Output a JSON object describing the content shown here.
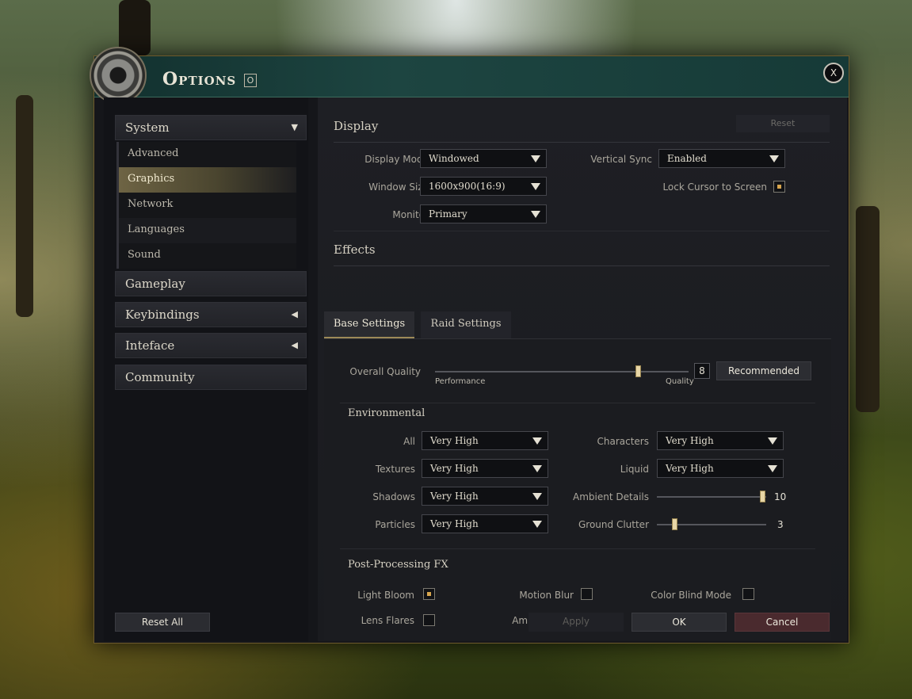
{
  "window": {
    "title": "Options",
    "title_key": "O",
    "close_label": "X"
  },
  "nav": {
    "system": "System",
    "system_subitems": [
      "Advanced",
      "Graphics",
      "Network",
      "Languages",
      "Sound"
    ],
    "active_subitem": "Graphics",
    "gameplay": "Gameplay",
    "keybindings": "Keybindings",
    "interface": "Inteface",
    "community": "Community",
    "reset_all": "Reset All"
  },
  "display": {
    "title": "Display",
    "reset": "Reset",
    "display_mode_label": "Display Mode",
    "display_mode": "Windowed",
    "window_size_label": "Window Size",
    "window_size": "1600x900(16:9)",
    "monitor_label": "Monitor",
    "monitor": "Primary",
    "vsync_label": "Vertical Sync",
    "vsync": "Enabled",
    "lock_cursor_label": "Lock Cursor to Screen",
    "lock_cursor": true
  },
  "effects": {
    "title": "Effects",
    "tabs": [
      "Base Settings",
      "Raid Settings"
    ],
    "active_tab": "Base Settings",
    "overall_quality_label": "Overall Quality",
    "overall_quality": 8,
    "overall_quality_max": 10,
    "performance_label": "Performance",
    "quality_label": "Quality",
    "recommended_button": "Recommended",
    "environmental_title": "Environmental",
    "all_label": "All",
    "all": "Very High",
    "textures_label": "Textures",
    "textures": "Very High",
    "shadows_label": "Shadows",
    "shadows": "Very High",
    "particles_label": "Particles",
    "particles": "Very High",
    "characters_label": "Characters",
    "characters": "Very High",
    "liquid_label": "Liquid",
    "liquid": "Very High",
    "ambient_details_label": "Ambient Details",
    "ambient_details": "10",
    "ground_clutter_label": "Ground Clutter",
    "ground_clutter": "3",
    "post_fx_title": "Post-Processing FX",
    "light_bloom_label": "Light Bloom",
    "light_bloom": true,
    "motion_blur_label": "Motion Blur",
    "motion_blur": false,
    "color_blind_label": "Color Blind Mode",
    "color_blind": false,
    "lens_flares_label": "Lens Flares",
    "lens_flares": false,
    "ambient_fog_label": "Ambient Fog",
    "ambient_fog": true
  },
  "footer": {
    "apply": "Apply",
    "ok": "OK",
    "cancel": "Cancel"
  },
  "colors": {
    "accent": "#d8a64e",
    "title_bar": "#1d4541",
    "cancel": "#4a2a2e"
  }
}
